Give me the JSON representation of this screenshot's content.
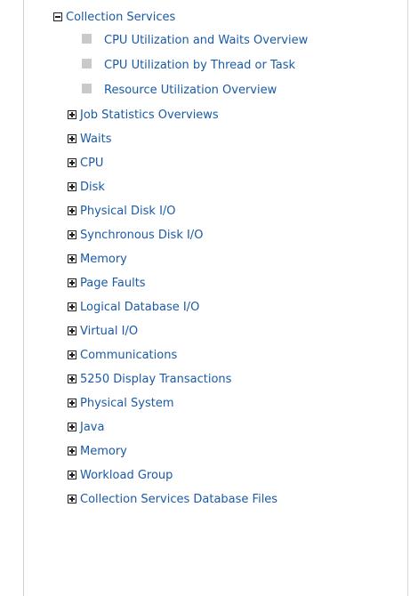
{
  "tree": {
    "root": {
      "label": "Collection Services",
      "expanded": true
    },
    "leaves": [
      {
        "label": "CPU Utilization and Waits Overview"
      },
      {
        "label": "CPU Utilization by Thread or Task"
      },
      {
        "label": "Resource Utilization Overview"
      }
    ],
    "groups": [
      {
        "label": "Job Statistics Overviews"
      },
      {
        "label": "Waits"
      },
      {
        "label": "CPU"
      },
      {
        "label": "Disk"
      },
      {
        "label": "Physical Disk I/O"
      },
      {
        "label": "Synchronous Disk I/O"
      },
      {
        "label": "Memory"
      },
      {
        "label": "Page Faults"
      },
      {
        "label": "Logical Database I/O"
      },
      {
        "label": "Virtual I/O"
      },
      {
        "label": "Communications"
      },
      {
        "label": "5250 Display Transactions"
      },
      {
        "label": "Physical System"
      },
      {
        "label": "Java"
      },
      {
        "label": "Memory"
      },
      {
        "label": "Workload Group"
      },
      {
        "label": "Collection Services Database Files"
      }
    ]
  },
  "colors": {
    "link": "#1a5aa6",
    "leaf_bullet": "#c9c9c9",
    "toggle_border": "#1f1f1f"
  },
  "icons": {
    "collapse": "minus-box-icon",
    "expand": "plus-box-icon",
    "leaf": "gray-square-icon"
  }
}
